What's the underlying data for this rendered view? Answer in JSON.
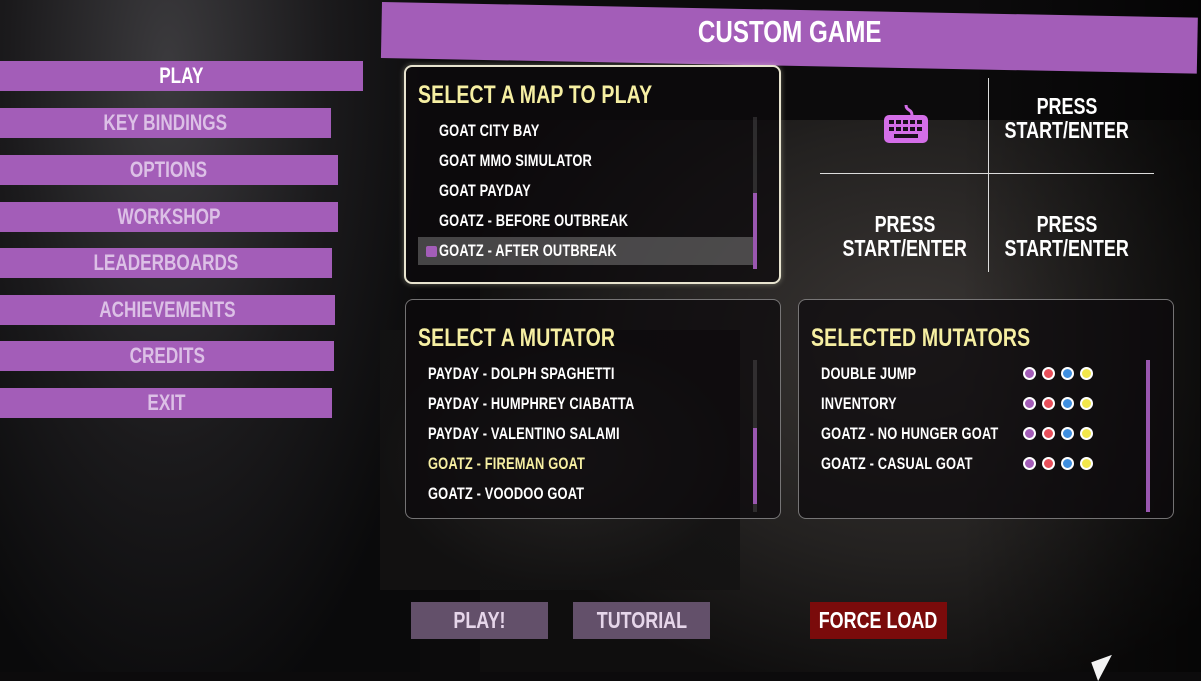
{
  "header": {
    "title": "CUSTOM GAME"
  },
  "menu": {
    "items": [
      {
        "label": "PLAY",
        "active": true
      },
      {
        "label": "KEY BINDINGS",
        "active": false
      },
      {
        "label": "OPTIONS",
        "active": false
      },
      {
        "label": "WORKSHOP",
        "active": false
      },
      {
        "label": "LEADERBOARDS",
        "active": false
      },
      {
        "label": "ACHIEVEMENTS",
        "active": false
      },
      {
        "label": "CREDITS",
        "active": false
      },
      {
        "label": "EXIT",
        "active": false
      }
    ]
  },
  "map_panel": {
    "title": "SELECT A MAP TO PLAY",
    "maps": [
      "GOAT CITY BAY",
      "GOAT MMO SIMULATOR",
      "GOAT PAYDAY",
      "GOATZ - BEFORE OUTBREAK",
      "GOATZ - AFTER OUTBREAK"
    ],
    "selected_index": 4
  },
  "players": {
    "slots": [
      {
        "type": "keyboard",
        "icon": "keyboard-icon"
      },
      {
        "type": "prompt",
        "line1": "PRESS",
        "line2": "START/ENTER"
      },
      {
        "type": "prompt",
        "line1": "PRESS",
        "line2": "START/ENTER"
      },
      {
        "type": "prompt",
        "line1": "PRESS",
        "line2": "START/ENTER"
      }
    ]
  },
  "mutator_panel": {
    "title": "SELECT A MUTATOR",
    "mutators": [
      "PAYDAY - DOLPH SPAGHETTI",
      "PAYDAY - HUMPHREY CIABATTA",
      "PAYDAY - VALENTINO SALAMI",
      "GOATZ - FIREMAN GOAT",
      "GOATZ - VOODOO GOAT"
    ],
    "highlighted_index": 3
  },
  "selected_mutators": {
    "title": "SELECTED MUTATORS",
    "items": [
      "DOUBLE JUMP",
      "INVENTORY",
      "GOATZ - NO HUNGER GOAT",
      "GOATZ - CASUAL GOAT"
    ],
    "player_colors": [
      "#a35db8",
      "#e8505b",
      "#3f8fe0",
      "#f2e64a"
    ]
  },
  "buttons": {
    "play": "PLAY!",
    "tutorial": "TUTORIAL",
    "force_load": "FORCE LOAD"
  },
  "colors": {
    "accent": "#a35db8",
    "title_yellow": "#f6efa2",
    "button_muted": "#63506a",
    "force_red": "#7a0b0b"
  }
}
